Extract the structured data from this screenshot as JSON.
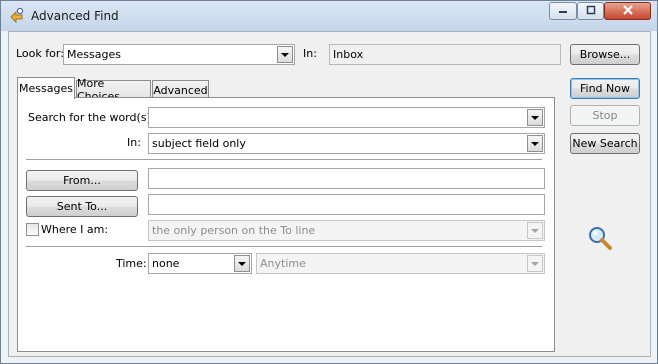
{
  "window": {
    "title": "Advanced Find",
    "controls": {
      "minimize": "minimize",
      "maximize": "maximize",
      "close": "close"
    }
  },
  "lookfor": {
    "label": "Look for:",
    "value": "Messages"
  },
  "in_folder": {
    "label": "In:",
    "value": "Inbox"
  },
  "buttons": {
    "browse": "Browse...",
    "find_now": "Find Now",
    "stop": "Stop",
    "new_search": "New Search"
  },
  "tabs": [
    {
      "label": "Messages",
      "active": true
    },
    {
      "label": "More Choices",
      "active": false
    },
    {
      "label": "Advanced",
      "active": false
    }
  ],
  "messages_tab": {
    "search_words_label": "Search for the word(s):",
    "search_words_value": "",
    "in_label": "In:",
    "in_value": "subject field only",
    "from_button": "From...",
    "from_value": "",
    "sent_to_button": "Sent To...",
    "sent_to_value": "",
    "where_i_am_label": "Where I am:",
    "where_i_am_checked": false,
    "where_i_am_value": "the only person on the To line",
    "time_label": "Time:",
    "time_value": "none",
    "time_range_value": "Anytime"
  },
  "icons": {
    "title": "advanced-find-icon",
    "magnifier": "magnifier-icon"
  }
}
